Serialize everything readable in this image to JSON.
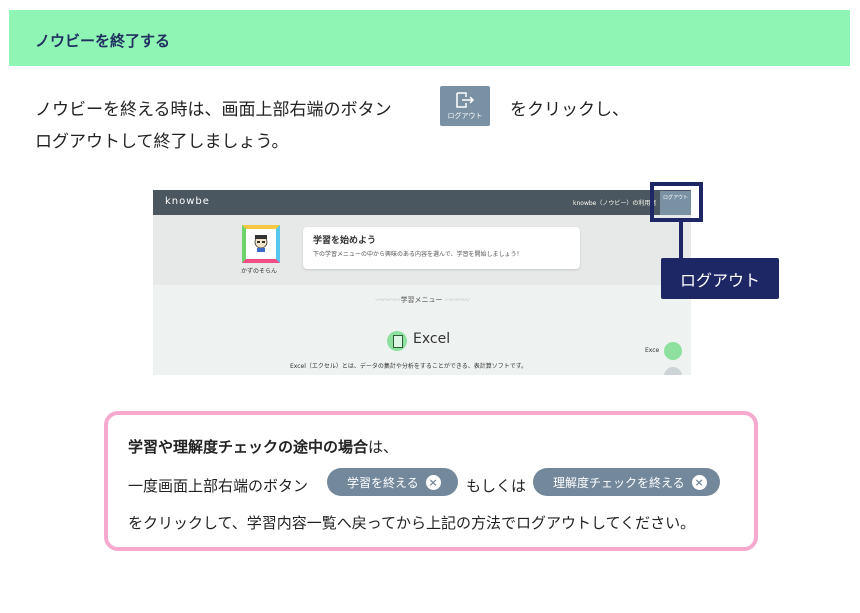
{
  "header": {
    "title": "ノウビーを終了する",
    "band_color": "#8ff5b4"
  },
  "intro": {
    "line1_before": "ノウビーを終える時は、画面上部右端のボタン",
    "line1_after": "をクリックし、",
    "line2": "ログアウトして終了しましょう。",
    "button_label": "ログアウト",
    "button_icon": "logout-icon"
  },
  "screenshot": {
    "logo": "knowbe",
    "user_text": "knowbe（ノウビー）の利用者",
    "logout_text": "ログアウト",
    "avatar_name": "かずのそらん",
    "card_title": "学習を始めよう",
    "card_text": "下の学習メニューの中から興味のある内容を選んで、学習を開始しましょう！",
    "menu_label": "学習メニュー",
    "course_label": "Excel",
    "course_desc": "Excel（エクセル）とは、データの集計や分析をすることができる、表計算ソフトです。",
    "side_label": "Exce"
  },
  "callout": {
    "label": "ログアウト",
    "color": "#1e2766"
  },
  "note": {
    "line1_bold": "学習や理解度チェックの途中の場合",
    "line1_rest": "は、",
    "line2_before": "一度画面上部右端のボタン",
    "pill1_label": "学習を終える",
    "middle": "もしくは",
    "pill2_label": "理解度チェックを終える",
    "line3": "をクリックして、学習内容一覧へ戻ってから上記の方法でログアウトしてください。",
    "border_color": "#f6a9cf"
  }
}
